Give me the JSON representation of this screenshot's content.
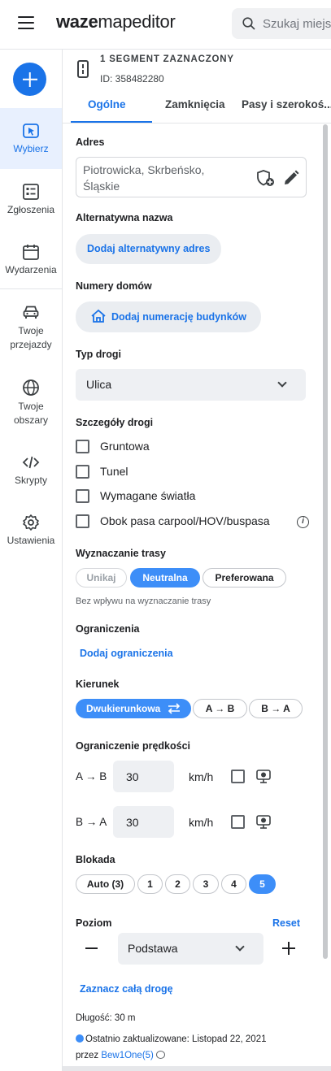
{
  "app": {
    "logo_bold": "waze",
    "logo_light": "mapeditor",
    "search_placeholder": "Szukaj miejsc"
  },
  "nav": {
    "items": [
      {
        "label": "Wybierz",
        "icon": "select-icon"
      },
      {
        "label": "Zgłoszenia",
        "icon": "reports-icon"
      },
      {
        "label": "Wydarzenia",
        "icon": "events-icon"
      },
      {
        "label": "Twoje przejazdy",
        "icon": "car-icon"
      },
      {
        "label": "Twoje obszary",
        "icon": "globe-icon"
      },
      {
        "label": "Skrypty",
        "icon": "code-icon"
      },
      {
        "label": "Ustawienia",
        "icon": "gear-icon"
      }
    ]
  },
  "panel": {
    "selection_title": "1 SEGMENT ZAZNACZONY",
    "selection_id": "ID: 358482280",
    "tabs": [
      "Ogólne",
      "Zamknięcia",
      "Pasy i szerokoś..."
    ],
    "address_label": "Adres",
    "address_value": "Piotrowicka, Skrbeńsko, Śląskie",
    "alt_name_label": "Alternatywna nazwa",
    "alt_name_button": "Dodaj alternatywny adres",
    "house_numbers_label": "Numery domów",
    "house_numbers_button": "Dodaj numerację budynków",
    "road_type_label": "Typ drogi",
    "road_type_value": "Ulica",
    "road_details_label": "Szczegóły drogi",
    "road_details": [
      "Gruntowa",
      "Tunel",
      "Wymagane światła",
      "Obok pasa carpool/HOV/buspasa"
    ],
    "routing_label": "Wyznaczanie trasy",
    "routing_options": [
      "Unikaj",
      "Neutralna",
      "Preferowana"
    ],
    "routing_hint": "Bez wpływu na wyznaczanie trasy",
    "restrictions_label": "Ograniczenia",
    "restrictions_link": "Dodaj ograniczenia",
    "direction_label": "Kierunek",
    "direction_options": [
      "Dwukierunkowa",
      "A → B",
      "B → A"
    ],
    "speed_label": "Ograniczenie prędkości",
    "speed_rows": [
      {
        "dir": "A → B",
        "value": "30",
        "unit": "km/h"
      },
      {
        "dir": "B → A",
        "value": "30",
        "unit": "km/h"
      }
    ],
    "lock_label": "Blokada",
    "lock_options": [
      "Auto (3)",
      "1",
      "2",
      "3",
      "4",
      "5"
    ],
    "level_label": "Poziom",
    "level_reset": "Reset",
    "level_value": "Podstawa",
    "select_road_link": "Zaznacz całą drogę",
    "length": "Długość: 30 m",
    "updated": "Ostatnio zaktualizowane: Listopad 22, 2021",
    "updated_by_prefix": "przez",
    "updated_by_user": "Bew1One(5)"
  },
  "colors": {
    "accent": "#1a73e8",
    "selected_chip": "#3d8ef8",
    "nav_active_bg": "#e8f0fe"
  }
}
